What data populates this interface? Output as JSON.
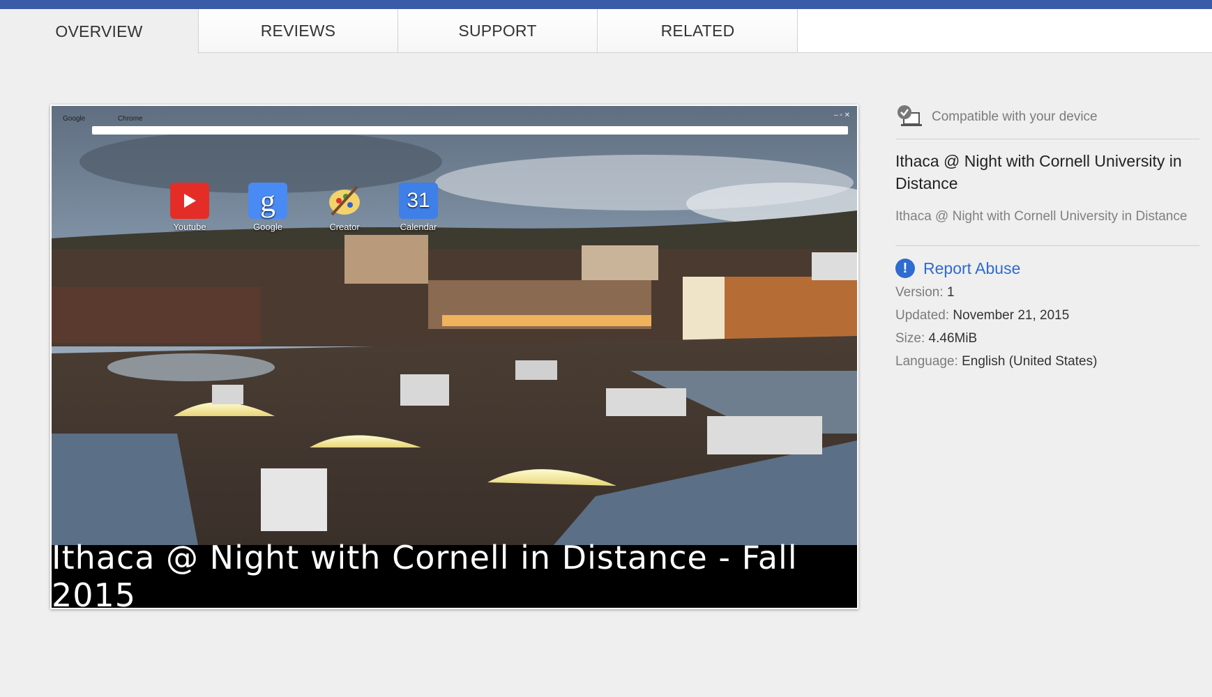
{
  "tabs": [
    {
      "label": "OVERVIEW"
    },
    {
      "label": "REVIEWS"
    },
    {
      "label": "SUPPORT"
    },
    {
      "label": "RELATED"
    }
  ],
  "screenshot": {
    "browser_tabs": [
      "Google",
      "Chrome"
    ],
    "apps": [
      {
        "label": "Youtube",
        "icon": "youtube-icon"
      },
      {
        "label": "Google",
        "icon": "google-icon"
      },
      {
        "label": "Creator",
        "icon": "paint-palette-icon"
      },
      {
        "label": "Calendar",
        "icon": "calendar-icon",
        "badge": "31"
      }
    ],
    "caption": "Ithaca @ Night with Cornell in Distance  - Fall 2015"
  },
  "sidebar": {
    "compatible": "Compatible with your device",
    "title": "Ithaca @ Night with Cornell University in Distance",
    "description": "Ithaca @ Night with Cornell University in Distance",
    "report": "Report Abuse",
    "version_label": "Version:",
    "version": "1",
    "updated_label": "Updated:",
    "updated": "November 21, 2015",
    "size_label": "Size:",
    "size": "4.46MiB",
    "language_label": "Language:",
    "language": "English (United States)"
  },
  "colors": {
    "topbar": "#3a5ba7",
    "link": "#2f6bd0",
    "background": "#efefef"
  }
}
